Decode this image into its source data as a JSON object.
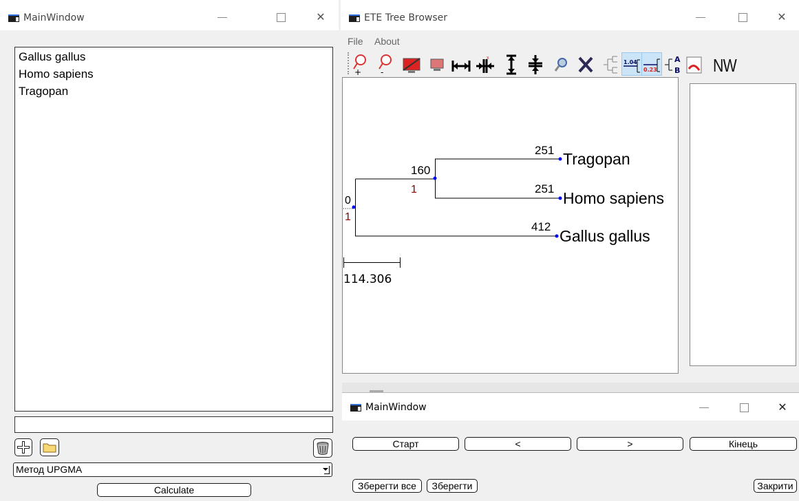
{
  "left_window": {
    "title": "MainWindow",
    "species": [
      "Gallus gallus",
      "Homo sapiens",
      "Tragopan"
    ],
    "input_value": "",
    "method_select": "Метод UPGMA",
    "calculate_label": "Calculate"
  },
  "ete_window": {
    "title": "ETE Tree Browser",
    "menu": [
      "File",
      "About"
    ],
    "toolbar_text": "NW",
    "tree": {
      "root_dist": "0",
      "root_support": "1",
      "inner_dist": "160",
      "inner_support": "1",
      "leaves": [
        {
          "dist": "251",
          "name": "Tragopan"
        },
        {
          "dist": "251",
          "name": "Homo sapiens"
        },
        {
          "dist": "412",
          "name": "Gallus gallus"
        }
      ],
      "scale_label": "114.306"
    }
  },
  "nav_window": {
    "title": "MainWindow",
    "start_label": "Старт",
    "prev_label": "<",
    "next_label": ">",
    "end_label": "Кінець",
    "save_all_label": "Зберегти все",
    "save_label": "Зберегти",
    "close_label": "Закрити"
  },
  "colors": {
    "node_blue": "#0000ff",
    "support_red": "#8b0000",
    "accent_blue": "#2f6fdc"
  },
  "icons": [
    "add-icon",
    "folder-icon",
    "trash-icon",
    "zoom-in-icon",
    "zoom-out-icon",
    "chevron-down-icon"
  ]
}
